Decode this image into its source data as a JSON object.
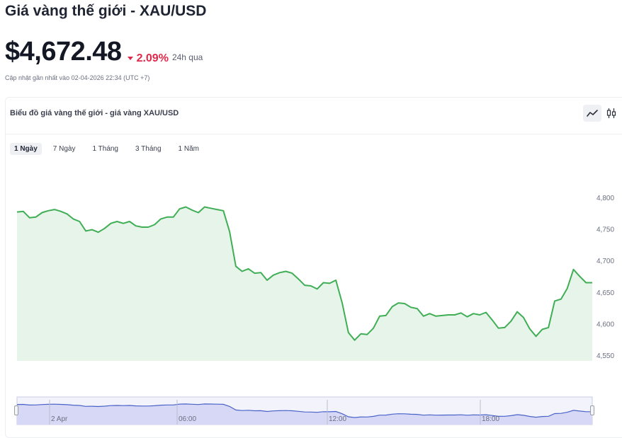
{
  "header": {
    "title": "Giá vàng thế giới - XAU/USD",
    "price": "$4,672.48",
    "change_pct": "2.09%",
    "change_direction": "down",
    "change_period": "24h qua",
    "updated": "Cập nhật gần nhất vào 02-04-2026 22:34 (UTC +7)"
  },
  "chart_panel": {
    "title": "Biểu đồ giá vàng thế giới - giá vàng XAU/USD",
    "tabs": [
      "1 Ngày",
      "7 Ngày",
      "1 Tháng",
      "3 Tháng",
      "1 Năm"
    ],
    "active_tab": 0,
    "view_toggles": [
      "line-chart-icon",
      "candlestick-icon"
    ]
  },
  "colors": {
    "line": "#3fae55",
    "area": "#e7f4ea",
    "negative": "#e0294a",
    "navigator_fill": "#d7d8f5",
    "navigator_line": "#4a63c9"
  },
  "chart_data": {
    "type": "area",
    "y_ticks": [
      "4,800",
      "4,750",
      "4,700",
      "4,650",
      "4,600",
      "4,550"
    ],
    "ylim": [
      4550,
      4800
    ],
    "x_axis_labels": [
      "2 Apr",
      "06:00",
      "12:00",
      "18:00"
    ],
    "grid": false,
    "legend": "none",
    "series": [
      {
        "values": [
          4778,
          4779,
          4769,
          4770,
          4777,
          4780,
          4782,
          4779,
          4775,
          4767,
          4763,
          4748,
          4750,
          4746,
          4752,
          4760,
          4763,
          4760,
          4763,
          4756,
          4754,
          4754,
          4758,
          4767,
          4770,
          4770,
          4783,
          4786,
          4781,
          4777,
          4786,
          4784,
          4782,
          4780,
          4747,
          4692,
          4684,
          4688,
          4681,
          4682,
          4670,
          4678,
          4682,
          4684,
          4681,
          4672,
          4662,
          4661,
          4656,
          4666,
          4665,
          4670,
          4634,
          4587,
          4575,
          4585,
          4584,
          4594,
          4613,
          4614,
          4628,
          4634,
          4633,
          4627,
          4625,
          4613,
          4617,
          4613,
          4614,
          4615,
          4615,
          4618,
          4612,
          4617,
          4615,
          4619,
          4607,
          4594,
          4595,
          4605,
          4620,
          4611,
          4593,
          4581,
          4592,
          4595,
          4637,
          4640,
          4657,
          4687,
          4676,
          4666,
          4666
        ]
      }
    ]
  }
}
